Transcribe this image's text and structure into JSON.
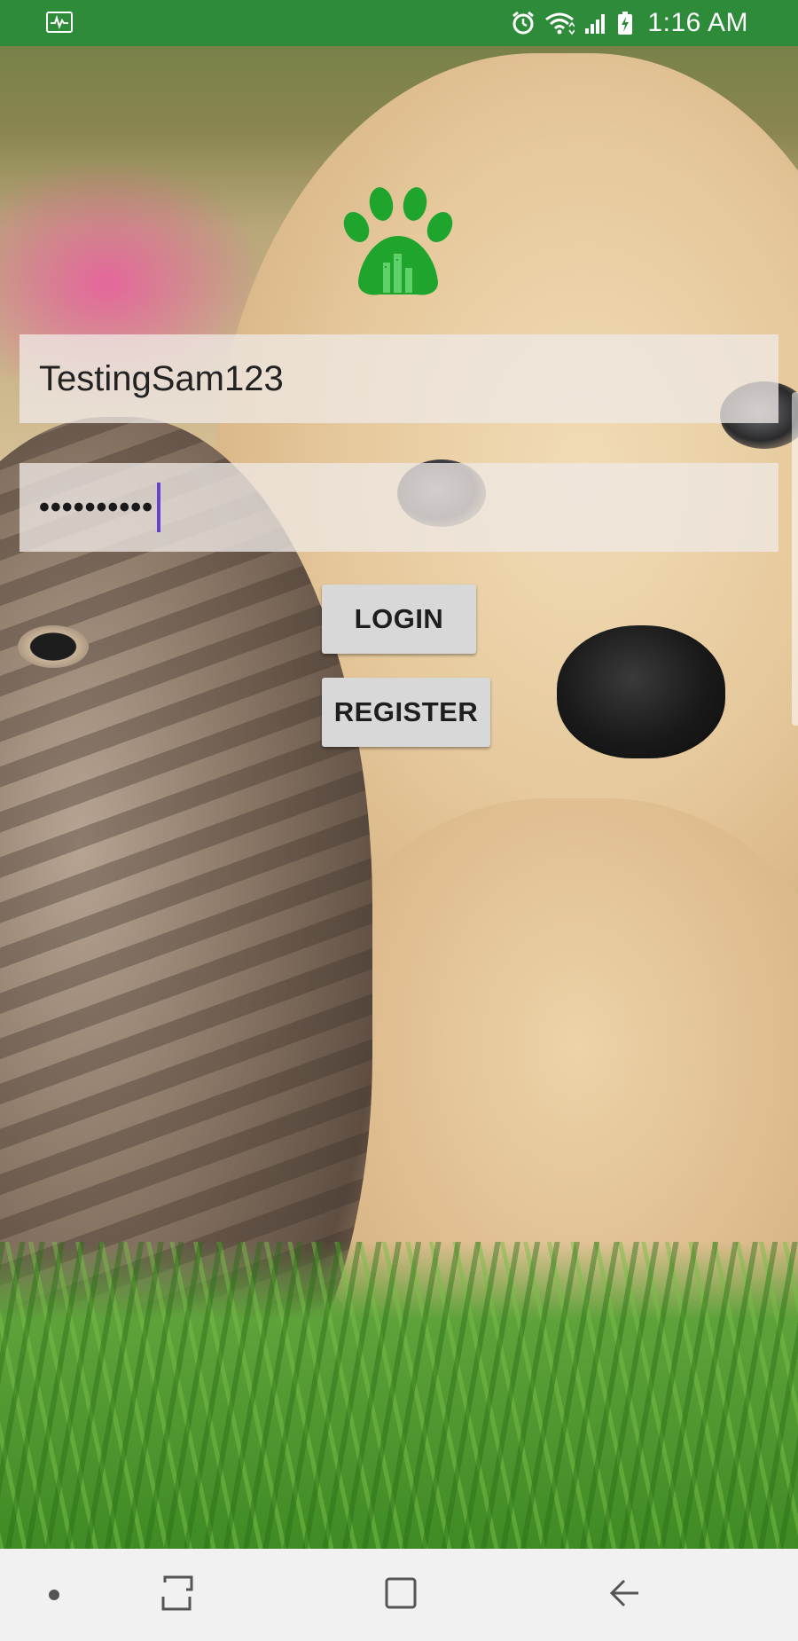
{
  "status_bar": {
    "time": "1:16 AM",
    "icons": [
      "activity-icon",
      "alarm-icon",
      "wifi-icon",
      "signal-icon",
      "battery-charging-icon"
    ],
    "background_color": "#2e8b3a"
  },
  "app": {
    "logo_icon": "paw-building-logo",
    "logo_color": "#1fa52e",
    "username_value": "TestingSam123",
    "password_value": "••••••••••",
    "login_label": "LOGIN",
    "register_label": "REGISTER",
    "background_image": "puppy-and-kitten-photo"
  },
  "nav_bar": {
    "buttons": [
      "recents-button",
      "home-button",
      "back-button"
    ]
  }
}
